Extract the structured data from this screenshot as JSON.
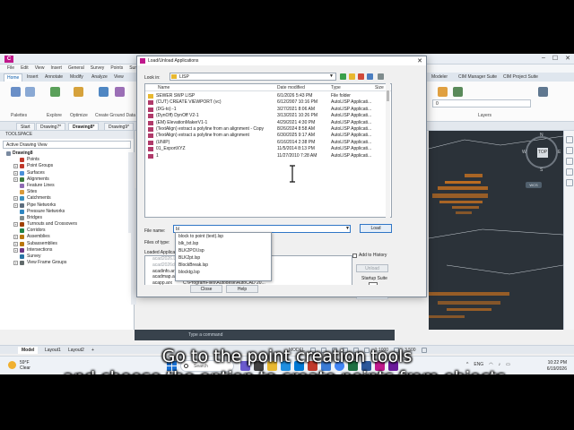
{
  "app": {
    "logo": "C",
    "menu": [
      "File",
      "Edit",
      "View",
      "Insert",
      "General",
      "Survey",
      "Points",
      "Surfaces"
    ],
    "ribbon_tabs": [
      "Home",
      "Insert",
      "Annotate",
      "Modify",
      "Analyze",
      "View",
      "Manage",
      "Output",
      "Survey",
      "Rail",
      "Autodesk InfraWorks",
      "Help",
      "Toposheet",
      "Modeler",
      "CIM Manager Suite",
      "CIM Project Suite"
    ],
    "ribbon_groups": [
      "Palettes",
      "Explore",
      "Optimize",
      "Create Ground Data",
      "Layers"
    ],
    "ribbon_buttons": [
      "Design Profile",
      "Create Profile",
      "Geometric Properties",
      "Layer Properties"
    ]
  },
  "file_tabs": [
    "Start",
    "Drawing7*",
    "Drawing8*",
    "Drawing9*"
  ],
  "toolspace": {
    "header": "TOOLSPACE",
    "view": "Active Drawing View",
    "root": "Drawing8",
    "items": [
      "Points",
      "Point Groups",
      "Surfaces",
      "Alignments",
      "Feature Lines",
      "Sites",
      "Catchments",
      "Pipe Networks",
      "Pressure Networks",
      "Bridges",
      "Turnouts and Crossovers",
      "Corridors",
      "Assemblies",
      "Subassemblies",
      "Intersections",
      "Survey",
      "View Frame Groups"
    ]
  },
  "viewcube": {
    "top": "TOP",
    "n": "N",
    "s": "S",
    "e": "E",
    "w": "W",
    "wcs": "WCS"
  },
  "dialog": {
    "title": "Load/Unload Applications",
    "look_in_label": "Look in:",
    "look_in_value": "LISP",
    "columns": [
      "Name",
      "Date modified",
      "Type",
      "Size"
    ],
    "files": [
      {
        "name": "SEWER SWP LISP",
        "date": "6/1/2026 5:43 PM",
        "type": "File folder",
        "kind": "folder"
      },
      {
        "name": "(CUT) CREATE VIEWPORT (vc)",
        "date": "6/12/2007 10:16 PM",
        "type": "AutoLISP Applicati...",
        "kind": "lsp"
      },
      {
        "name": "(DG-to) -1",
        "date": "3/27/2021 8:06 AM",
        "type": "AutoLISP Applicati...",
        "kind": "lsp"
      },
      {
        "name": "(DynOff) DynOff V2-1",
        "date": "3/13/2021 10:26 PM",
        "type": "AutoLISP Applicati...",
        "kind": "lsp"
      },
      {
        "name": "(EM) ElevationMakerV1-1",
        "date": "4/29/2021 4:30 PM",
        "type": "AutoLISP Applicati...",
        "kind": "lsp"
      },
      {
        "name": "(TextAlign) extract a polyline from an alignment - Copy",
        "date": "8/26/2024 8:58 AM",
        "type": "AutoLISP Applicati...",
        "kind": "lsp"
      },
      {
        "name": "(TextAlign) extract a polyline from an alignment",
        "date": "6/30/2025 9:17 AM",
        "type": "AutoLISP Applicati...",
        "kind": "lsp"
      },
      {
        "name": "(UNIP)",
        "date": "6/16/2014 2:38 PM",
        "type": "AutoLISP Applicati...",
        "kind": "lsp"
      },
      {
        "name": "01_ExportXYZ",
        "date": "11/5/2014 8:13 PM",
        "type": "AutoLISP Applicati...",
        "kind": "lsp"
      },
      {
        "name": "1",
        "date": "11/27/2010 7:28 AM",
        "type": "AutoLISP Applicati...",
        "kind": "lsp"
      }
    ],
    "file_name_label": "File name:",
    "file_name_value": "bl",
    "files_of_type_label": "Files of type:",
    "load_label": "Load",
    "autocomplete": [
      "block to point (text).lsp",
      "blk_txt.lsp",
      "BLK2POI.lsp",
      "BLK2pt.lsp",
      "BlockBreak.lsp",
      "blocktg.lsp"
    ],
    "loaded_label": "Loaded Applications",
    "loaded": [
      {
        "name": "acad2026.LSP",
        "path": "C:\\ProgramFiles\\Autodesk\\AutoCAD 20...",
        "dim": true
      },
      {
        "name": "acad2026doc.LSP",
        "path": "C:\\ProgramFiles\\Autodesk\\AutoCAD 20...",
        "dim": true
      },
      {
        "name": "acadinfo.arx",
        "path": "C:\\ProgramFiles\\Autodesk\\AutoCAD 20...",
        "dim": false
      },
      {
        "name": "acadmap.arx",
        "path": "C:\\ProgramFiles\\Autodesk\\AutoCAD 20...",
        "dim": false
      },
      {
        "name": "acapp.arx",
        "path": "C:\\ProgramFiles\\Autodesk\\AutoCAD 20...",
        "dim": false
      },
      {
        "name": "acaqp.arx",
        "path": "C:\\ProgramFiles\\Autodesk\\AutoCAD 20...",
        "dim": false
      },
      {
        "name": "acauthenvironm...",
        "path": "C:\\ProgramFiles\\Autodesk\\AutoCAD 20...",
        "dim": false
      },
      {
        "name": "AcAuthEnviron...",
        "path": "C:\\ProgramFiles\\Autodesk\\AutoCAD 20...",
        "dim": false
      },
      {
        "name": "acauthenvironm...",
        "path": "C:\\ProgramFiles\\Autodesk\\AutoCAD 20...",
        "dim": false
      },
      {
        "name": "acauthenvironm...",
        "path": "C:\\ProgramFiles\\Autodesk\\AutoCAD 20...",
        "dim": false
      }
    ],
    "add_history_label": "Add to History",
    "unload_label": "Unload",
    "startup_label": "Startup Suite",
    "contents_label": "Contents...",
    "close_label": "Close",
    "help_label": "Help"
  },
  "command_line": "Type a command",
  "layout_tabs": [
    "Model",
    "Layout1",
    "Layout2",
    "+"
  ],
  "status_right": {
    "model": "MODEL",
    "scale": "1:1000",
    "units": "3.500"
  },
  "taskbar": {
    "temp": "59°F",
    "weather": "Clear",
    "search": "Search",
    "lang": "ENG",
    "time": "10:22 PM",
    "date": "6/19/2026"
  },
  "subtitles": {
    "line1": "Go to the point creation tools",
    "line2": "and choose the option to create points from objects."
  },
  "colors": {
    "accent": "#0b5cad",
    "brand": "#c0188c",
    "drawing_bg": "#2b3239",
    "points": "#e07a1c"
  }
}
